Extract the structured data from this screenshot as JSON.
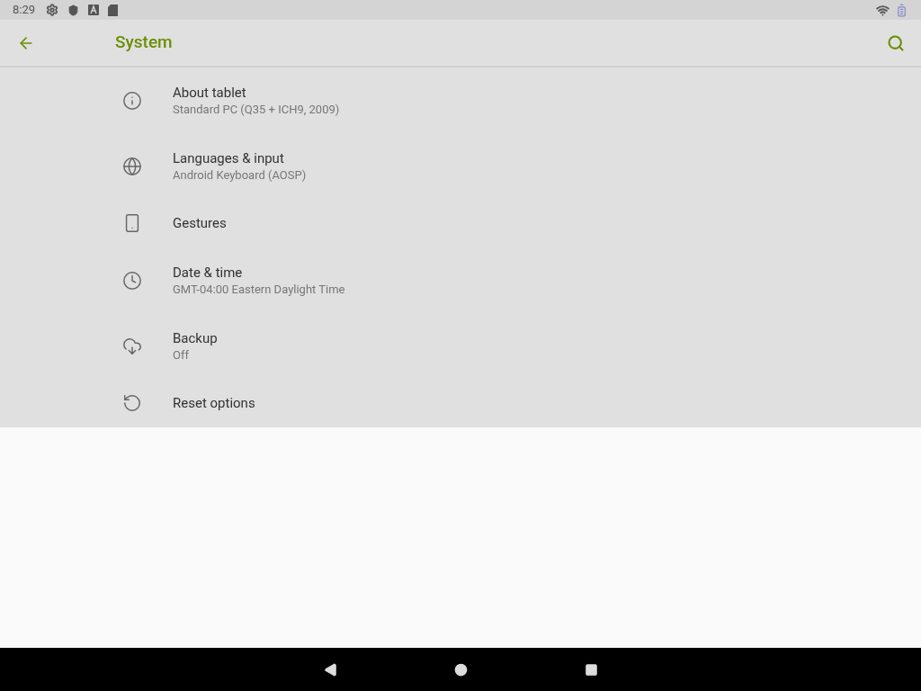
{
  "status_bar": {
    "time": "8:29"
  },
  "toolbar": {
    "title": "System"
  },
  "items": [
    {
      "title": "About tablet",
      "summary": "Standard PC (Q35 + ICH9, 2009)"
    },
    {
      "title": "Languages & input",
      "summary": "Android Keyboard (AOSP)"
    },
    {
      "title": "Gestures"
    },
    {
      "title": "Date & time",
      "summary": "GMT-04:00 Eastern Daylight Time"
    },
    {
      "title": "Backup",
      "summary": "Off"
    },
    {
      "title": "Reset options"
    }
  ]
}
